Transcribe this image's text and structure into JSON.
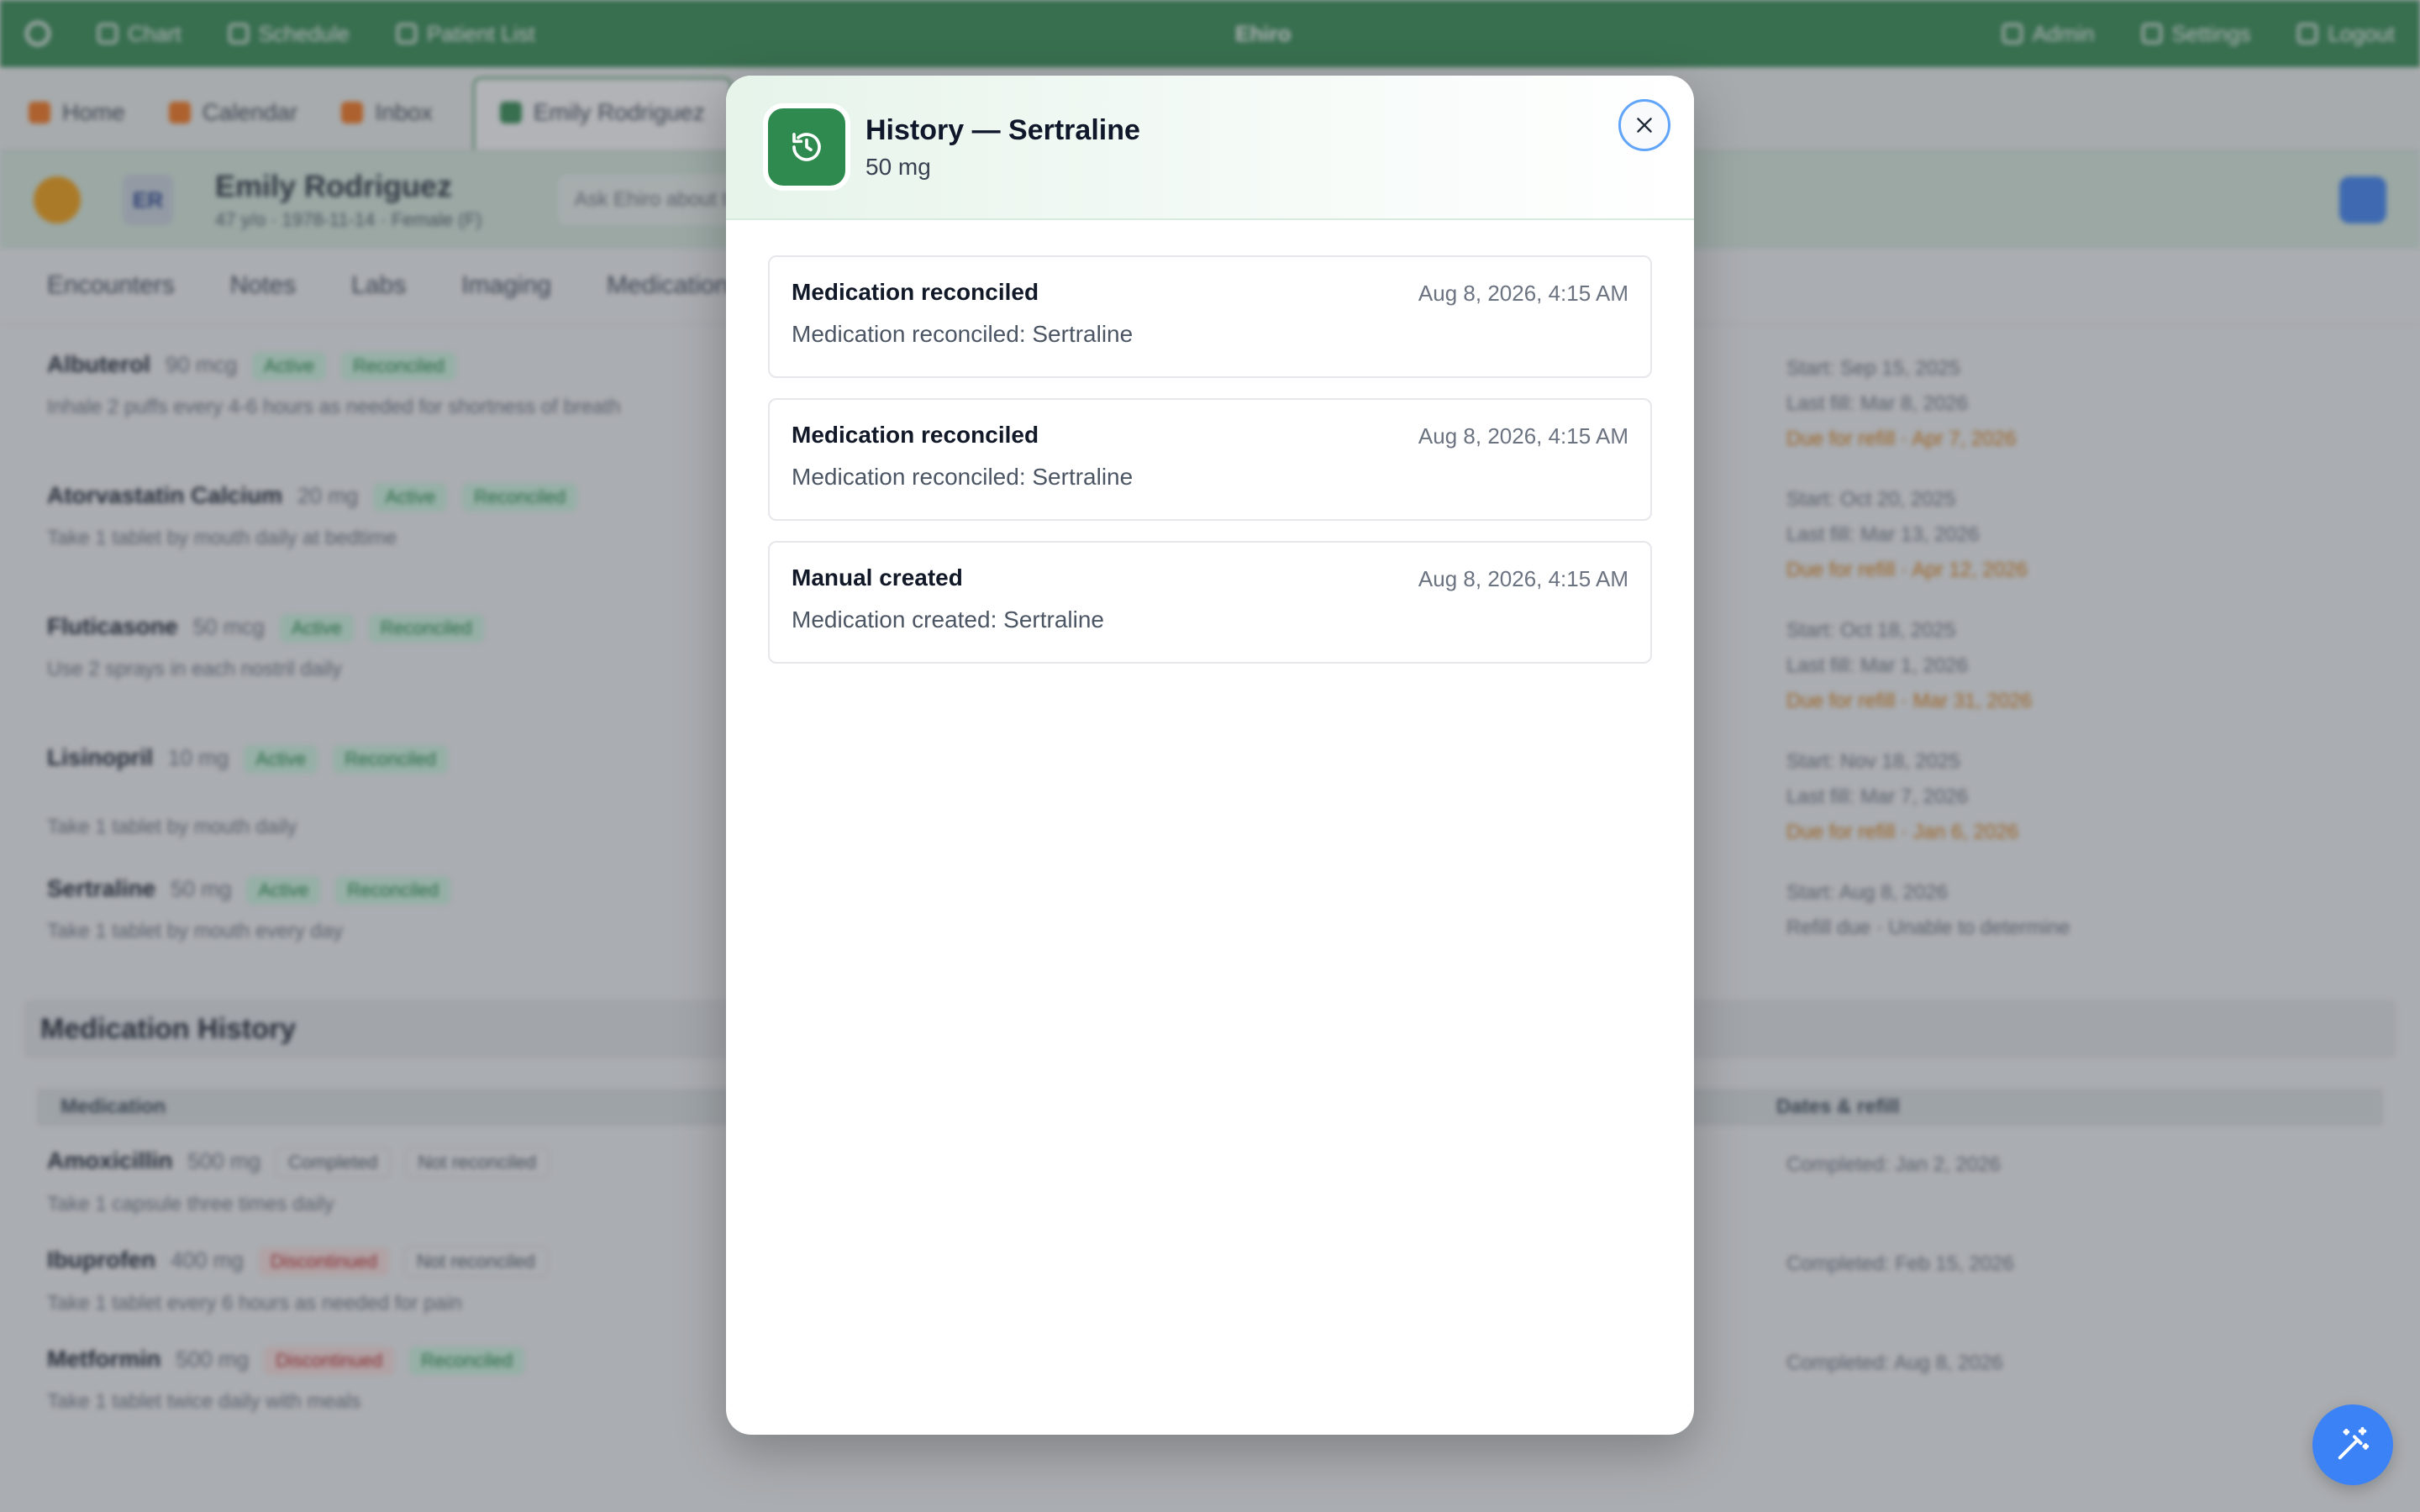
{
  "topbar": {
    "nav": [
      "Chart",
      "Schedule",
      "Patient List"
    ],
    "center": "Ehiro",
    "right": [
      "Admin",
      "Settings",
      "Logout"
    ]
  },
  "tabs": [
    "Home",
    "Calendar",
    "Inbox",
    "Emily Rodriguez"
  ],
  "patient": {
    "initials": "ER",
    "name": "Emily Rodriguez",
    "meta": "47 y/o · 1978-11-14 · Female (F)",
    "search_placeholder": "Ask Ehiro about this patient..."
  },
  "section_tabs": [
    "Encounters",
    "Notes",
    "Labs",
    "Imaging",
    "Medications"
  ],
  "active_meds": [
    {
      "name": "Albuterol",
      "dose": "90 mcg",
      "status": "Active",
      "recon": "Reconciled",
      "sig": "Inhale 2 puffs every 4-6 hours as needed for shortness of breath",
      "right": [
        "Start: Sep 15, 2025",
        "Last fill: Mar 8, 2026",
        "Due for refill · Apr 7, 2026"
      ]
    },
    {
      "name": "Atorvastatin Calcium",
      "dose": "20 mg",
      "status": "Active",
      "recon": "Reconciled",
      "sig": "Take 1 tablet by mouth daily at bedtime",
      "right": [
        "Start: Oct 20, 2025",
        "Last fill: Mar 13, 2026",
        "Due for refill · Apr 12, 2026"
      ]
    },
    {
      "name": "Fluticasone",
      "dose": "50 mcg",
      "status": "Active",
      "recon": "Reconciled",
      "sig": "Use 2 sprays in each nostril daily",
      "right": [
        "Start: Oct 18, 2025",
        "Last fill: Mar 1, 2026",
        "Due for refill · Mar 31, 2026"
      ]
    },
    {
      "name": "Lisinopril",
      "dose": "10 mg",
      "status": "Active",
      "recon": "Reconciled",
      "sig": "Take 1 tablet by mouth daily",
      "right": [
        "Start: Nov 18, 2025",
        "Last fill: Mar 7, 2026",
        "Due for refill · Jan 6, 2026"
      ]
    },
    {
      "name": "Sertraline",
      "dose": "50 mg",
      "status": "Active",
      "recon": "Reconciled",
      "sig": "Take 1 tablet by mouth every day",
      "right": [
        "Start: Aug 8, 2026",
        "Refill due · Unable to determine"
      ]
    }
  ],
  "history": {
    "title": "Medication History",
    "col_med": "Medication",
    "col_dates": "Dates & refill",
    "rows": [
      {
        "name": "Amoxicillin",
        "dose": "500 mg",
        "status": "Completed",
        "recon": "Not reconciled",
        "sig": "Take 1 capsule three times daily",
        "right": "Completed: Jan 2, 2026"
      },
      {
        "name": "Ibuprofen",
        "dose": "400 mg",
        "status": "Discontinued",
        "recon": "Not reconciled",
        "sig": "Take 1 tablet every 6 hours as needed for pain",
        "right": "Completed: Feb 15, 2026"
      },
      {
        "name": "Metformin",
        "dose": "500 mg",
        "status": "Discontinued",
        "recon": "Reconciled",
        "sig": "Take 1 tablet twice daily with meals",
        "right": "Completed: Aug 8, 2026"
      }
    ]
  },
  "modal": {
    "title": "History — Sertraline",
    "subtitle": "50 mg",
    "icon": "history-icon",
    "close_icon": "close-icon",
    "entries": [
      {
        "title": "Medication reconciled",
        "time": "Aug 8, 2026, 4:15 AM",
        "description": "Medication reconciled: Sertraline"
      },
      {
        "title": "Medication reconciled",
        "time": "Aug 8, 2026, 4:15 AM",
        "description": "Medication reconciled: Sertraline"
      },
      {
        "title": "Manual created",
        "time": "Aug 8, 2026, 4:15 AM",
        "description": "Medication created: Sertraline"
      }
    ]
  },
  "fab": {
    "icon": "magic-wand-icon"
  },
  "colors": {
    "brand": "#2f8a4f",
    "accent": "#3b82f6"
  }
}
